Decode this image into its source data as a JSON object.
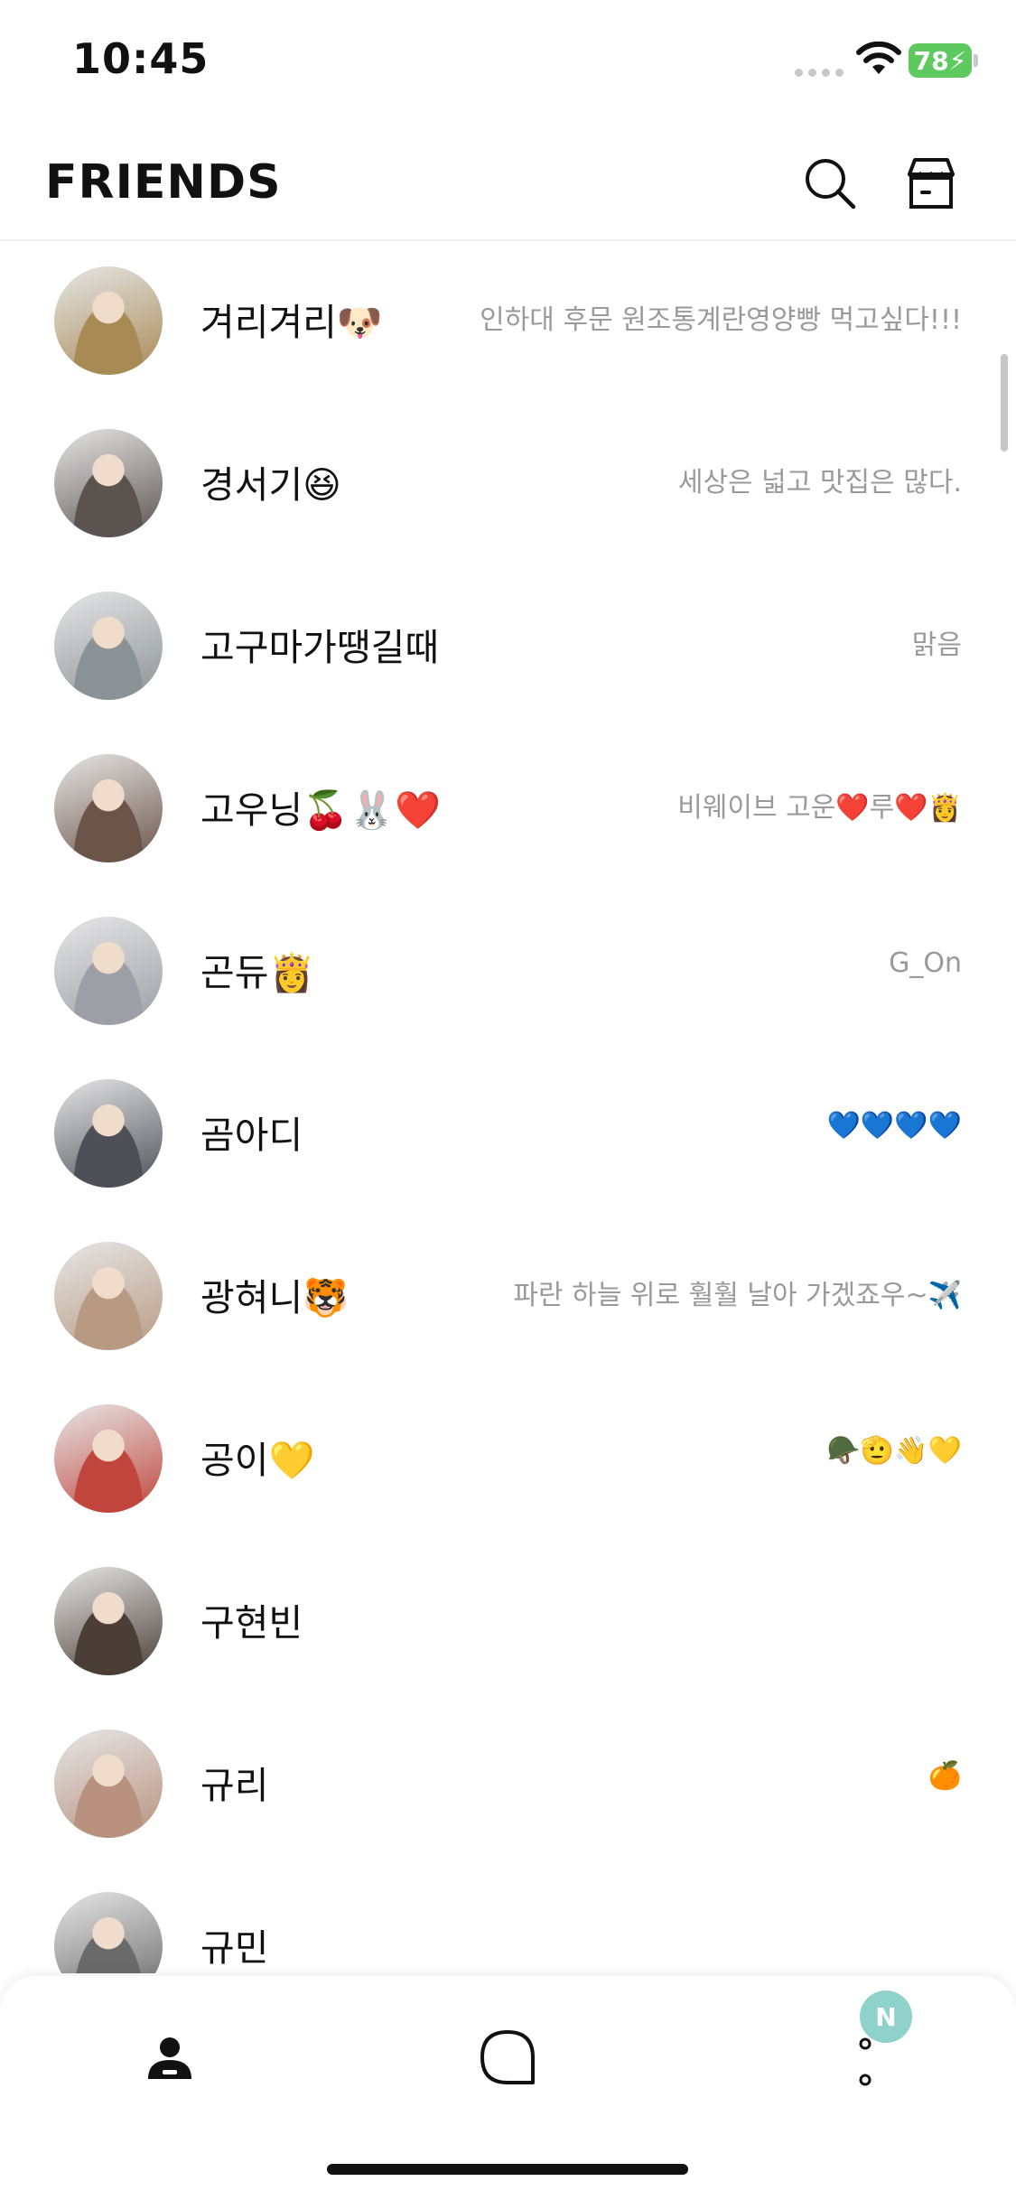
{
  "status_bar": {
    "time": "10:45",
    "battery": "78"
  },
  "header": {
    "title": "FRIENDS"
  },
  "friends": [
    {
      "name": "겨리겨리🐶",
      "status": "인하대 후문 원조통계란영양빵 먹고싶다!!!",
      "avatar_color": "#a88a55"
    },
    {
      "name": "경서기😆",
      "status": "세상은 넓고 맛집은 많다.",
      "avatar_color": "#5a5350"
    },
    {
      "name": "고구마가땡길때",
      "status": "맑음",
      "avatar_color": "#8b9295"
    },
    {
      "name": "고우닝🍒🐰❤️",
      "status": "비웨이브 고운❤️루❤️👸",
      "avatar_color": "#6b5448"
    },
    {
      "name": "곤듀👸",
      "status": "G_On",
      "avatar_color": "#9d9fa6"
    },
    {
      "name": "곰아디",
      "status": "💙💙💙💙",
      "avatar_color": "#4e5058"
    },
    {
      "name": "광혀니🐯",
      "status": "파란 하늘 위로 훨훨 날아 가겠죠우~✈️",
      "avatar_color": "#b89a82"
    },
    {
      "name": "공이💛",
      "status": "🪖🫡👋💛",
      "avatar_color": "#c0453c"
    },
    {
      "name": "구현빈",
      "status": "",
      "avatar_color": "#4a3e36"
    },
    {
      "name": "규리",
      "status": "🍊",
      "avatar_color": "#b8927e"
    },
    {
      "name": "규민",
      "status": "",
      "avatar_color": "#6a6a6a"
    }
  ],
  "tabbar": {
    "badge": "N"
  }
}
